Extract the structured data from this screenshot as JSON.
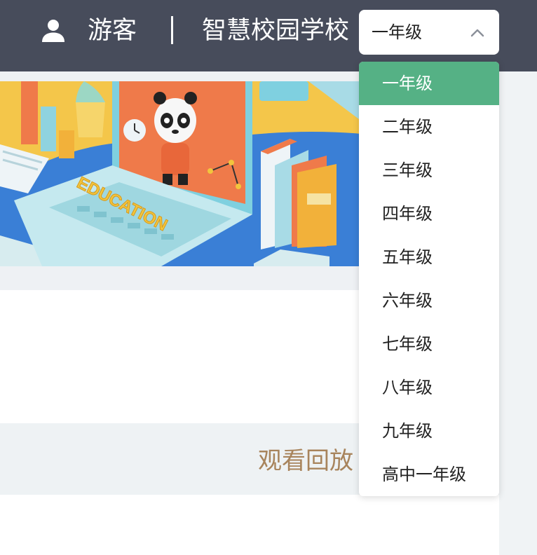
{
  "header": {
    "user_name": "游客",
    "school_name": "智慧校园学校",
    "grade_select": {
      "value": "一年级"
    }
  },
  "banner": {
    "laptop_keyboard_text": "EDUCATION"
  },
  "main": {
    "replay_label": "观看回放"
  },
  "dropdown": {
    "selected_index": 0,
    "items": [
      "一年级",
      "二年级",
      "三年级",
      "四年级",
      "五年级",
      "六年级",
      "七年级",
      "八年级",
      "九年级",
      "高中一年级"
    ]
  },
  "colors": {
    "header_bg": "#474c5b",
    "selected_item_bg": "#55b185",
    "replay_text": "#a8845c",
    "page_bg": "#eef1f4"
  },
  "icons": {
    "user": "user-icon",
    "select_chevron": "chevron-up-icon"
  }
}
